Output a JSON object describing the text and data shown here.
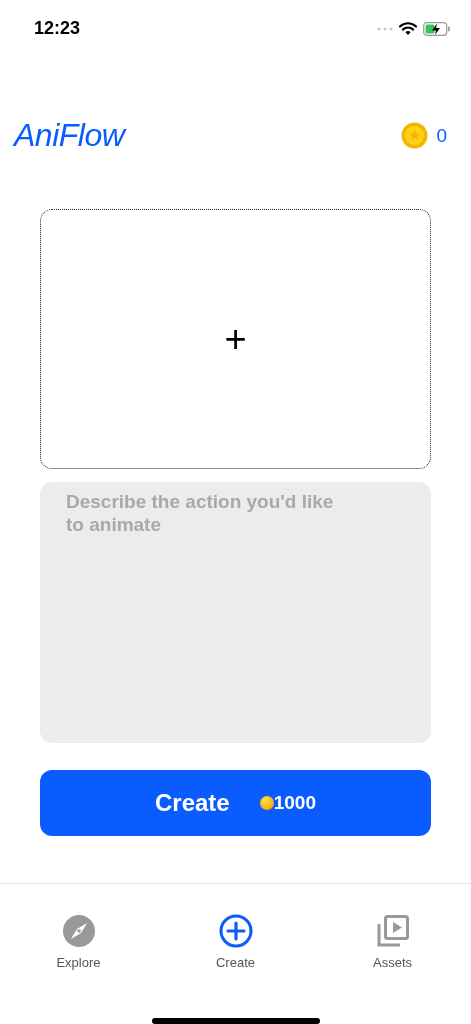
{
  "status_bar": {
    "time": "12:23",
    "charging": true
  },
  "header": {
    "logo": "AniFlow",
    "coins": "0"
  },
  "upload": {
    "symbol": "+"
  },
  "prompt": {
    "placeholder": "Describe the action you'd like to animate"
  },
  "create_button": {
    "label": "Create",
    "cost": "1000"
  },
  "tabs": [
    {
      "label": "Explore",
      "kind": "compass",
      "selected": false
    },
    {
      "label": "Create",
      "kind": "plus",
      "selected": true
    },
    {
      "label": "Assets",
      "kind": "play",
      "selected": false
    }
  ]
}
